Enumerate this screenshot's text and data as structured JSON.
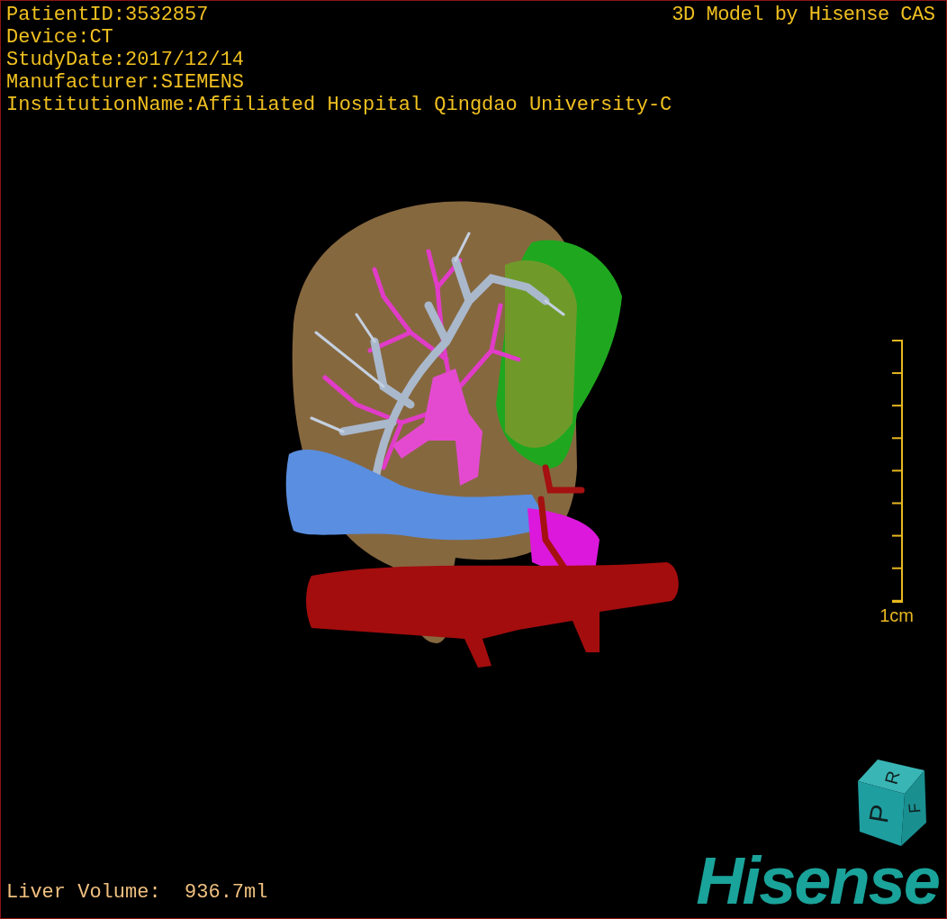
{
  "overlay": {
    "info_lines": [
      "PatientID:3532857",
      "Device:CT",
      "StudyDate:2017/12/14",
      "Manufacturer:SIEMENS",
      "InstitutionName:Affiliated Hospital Qingdao University-C"
    ],
    "title": "3D Model by Hisense CAS"
  },
  "scale_bar": {
    "label": "1cm"
  },
  "orientation_cube": {
    "faces": [
      "P",
      "R",
      "F"
    ]
  },
  "measurement": {
    "text": "Liver Volume:  936.7ml"
  },
  "logo": {
    "text": "Hisense"
  }
}
